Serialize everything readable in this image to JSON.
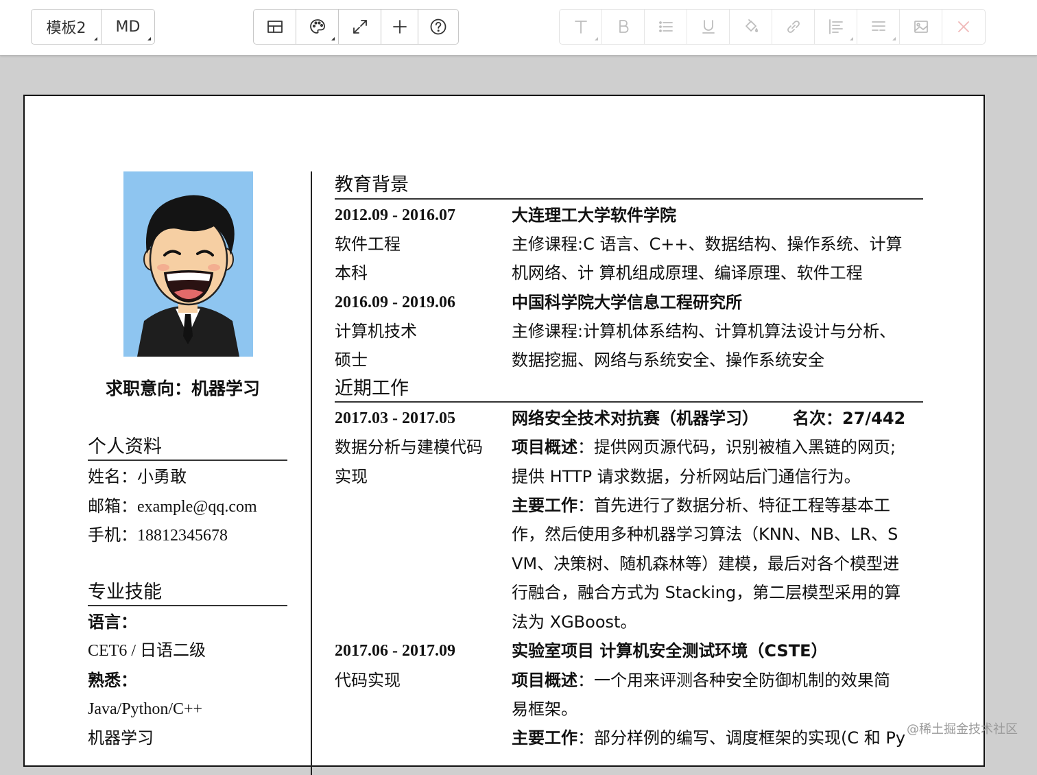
{
  "toolbar": {
    "template_label": "模板2",
    "md_label": "MD",
    "icons_mid": [
      "layout-icon",
      "palette-icon",
      "fullscreen-icon",
      "plus-icon",
      "help-icon"
    ],
    "icons_right": [
      "text-icon",
      "bold-icon",
      "list-icon",
      "underline-icon",
      "fill-icon",
      "link-icon",
      "align-icon",
      "line-spacing-icon",
      "image-icon",
      "close-icon"
    ]
  },
  "colors": {
    "accent": "#3c84c4",
    "text": "#111111",
    "canvas": "#cfcfcf"
  },
  "left": {
    "objective": "求职意向：机器学习",
    "profile": {
      "title": "个人资料",
      "name_label": "姓名：",
      "name_value": "小勇敢",
      "email_label": "邮箱：",
      "email_value": "example@qq.com",
      "phone_label": "手机：",
      "phone_value": "18812345678"
    },
    "skills": {
      "title": "专业技能",
      "lang_label": "语言：",
      "lang_value": "CET6 / 日语二级",
      "familiar_label": "熟悉：",
      "familiar_value1": "Java/Python/C++",
      "familiar_value2": "机器学习"
    }
  },
  "education": {
    "title": "教育背景",
    "items": [
      {
        "date": "2012.09 - 2016.07",
        "school": "大连理工大学软件学院",
        "major": "软件工程",
        "degree": "本科",
        "line1": "主修课程:C 语言、C++、数据结构、操作系统、计算",
        "line2": "机网络、计 算机组成原理、编译原理、软件工程"
      },
      {
        "date": "2016.09 - 2019.06",
        "school": "中国科学院大学信息工程研究所",
        "major": "计算机技术",
        "degree": "硕士",
        "line1": "主修课程:计算机体系结构、计算机算法设计与分析、",
        "line2": "数据挖掘、网络与系统安全、操作系统安全"
      }
    ]
  },
  "work": {
    "title": "近期工作",
    "items": [
      {
        "date": "2017.03 - 2017.05",
        "heading": "网络安全技术对抗赛（机器学习）",
        "rank": "名次：27/442",
        "role1": "数据分析与建模代码",
        "role2": "实现",
        "overview_label": "项目概述",
        "overview1": "：提供网页源代码，识别被植入黑链的网页;",
        "overview2": "提供 HTTP 请求数据，分析网站后门通信行为。",
        "main_label": "主要工作",
        "main1": "：首先进行了数据分析、特征工程等基本工",
        "main2": "作，然后使用多种机器学习算法（KNN、NB、LR、S",
        "main3": "VM、决策树、随机森林等）建模，最后对各个模型进",
        "main4": "行融合，融合方式为 Stacking，第二层模型采用的算",
        "main5": "法为 XGBoost。"
      },
      {
        "date": "2017.06 - 2017.09",
        "heading": "实验室项目 计算机安全测试环境（CSTE）",
        "role1": "代码实现",
        "overview_label": "项目概述",
        "overview1": "：一个用来评测各种安全防御机制的效果简",
        "overview2": "易框架。",
        "main_label": "主要工作",
        "main1": "：部分样例的编写、调度框架的实现(C 和 Py"
      }
    ]
  },
  "watermark": "@稀土掘金技术社区"
}
